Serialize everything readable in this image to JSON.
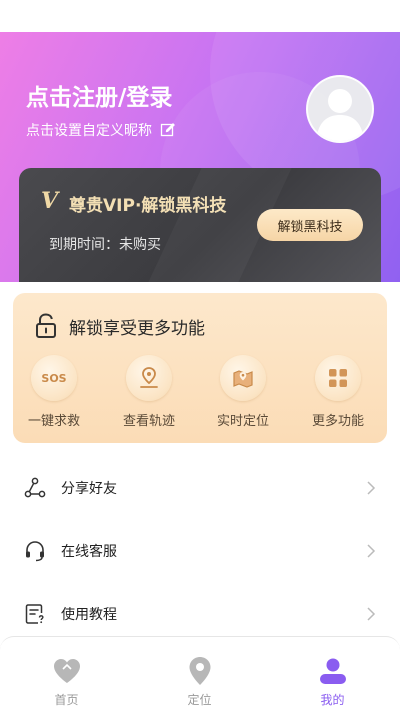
{
  "header": {
    "login_title": "点击注册/登录",
    "nickname_prompt": "点击设置自定义昵称"
  },
  "vip": {
    "badge": "V",
    "title": "尊贵VIP·解锁黑科技",
    "expire_text": "到期时间：未购买",
    "unlock_button": "解锁黑科技"
  },
  "features": {
    "title": "解锁享受更多功能",
    "items": [
      {
        "label": "一键求救",
        "icon": "sos-icon",
        "icon_text": "SOS"
      },
      {
        "label": "查看轨迹",
        "icon": "track-pin-icon"
      },
      {
        "label": "实时定位",
        "icon": "map-location-icon"
      },
      {
        "label": "更多功能",
        "icon": "grid-more-icon"
      }
    ]
  },
  "menu": [
    {
      "label": "分享好友",
      "icon": "share-icon"
    },
    {
      "label": "在线客服",
      "icon": "headset-icon"
    },
    {
      "label": "使用教程",
      "icon": "tutorial-doc-icon"
    }
  ],
  "tabbar": {
    "tabs": [
      {
        "label": "首页",
        "icon": "heart-icon",
        "active": false
      },
      {
        "label": "定位",
        "icon": "location-pin-icon",
        "active": false
      },
      {
        "label": "我的",
        "icon": "user-icon",
        "active": true
      }
    ]
  },
  "colors": {
    "accent": "#8a5cf0",
    "header_gradient_start": "#ee7ee6",
    "header_gradient_end": "#9061f1",
    "vip_gold": "#f3dfb4",
    "feature_card_bg": "#fde8cc",
    "inactive_tab": "#9a9a9a"
  }
}
